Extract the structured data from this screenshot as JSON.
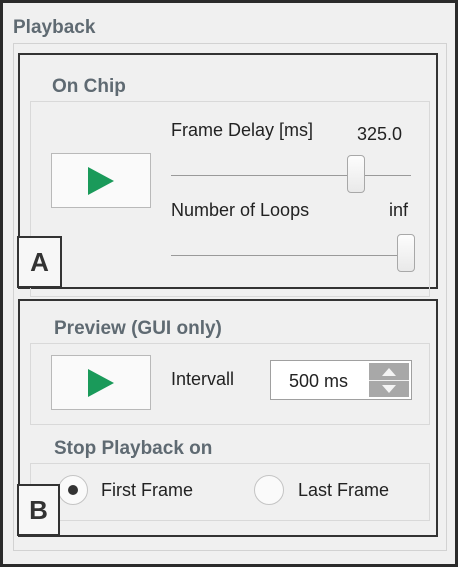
{
  "panel": {
    "title": "Playback"
  },
  "on_chip": {
    "title": "On Chip",
    "frame_delay": {
      "label": "Frame Delay [ms]",
      "value": "325.0",
      "slider_fraction": 0.77
    },
    "loops": {
      "label": "Number of Loops",
      "value": "inf",
      "slider_fraction": 0.98
    }
  },
  "preview": {
    "title": "Preview (GUI only)",
    "interval": {
      "label": "Intervall",
      "value": "500 ms"
    }
  },
  "stop": {
    "title": "Stop Playback on",
    "first_frame": "First Frame",
    "last_frame": "Last Frame",
    "selected": "first_frame"
  },
  "annotations": {
    "a": "A",
    "b": "B"
  },
  "colors": {
    "play": "#1a9a5a",
    "section_title": "#5f6a72"
  }
}
